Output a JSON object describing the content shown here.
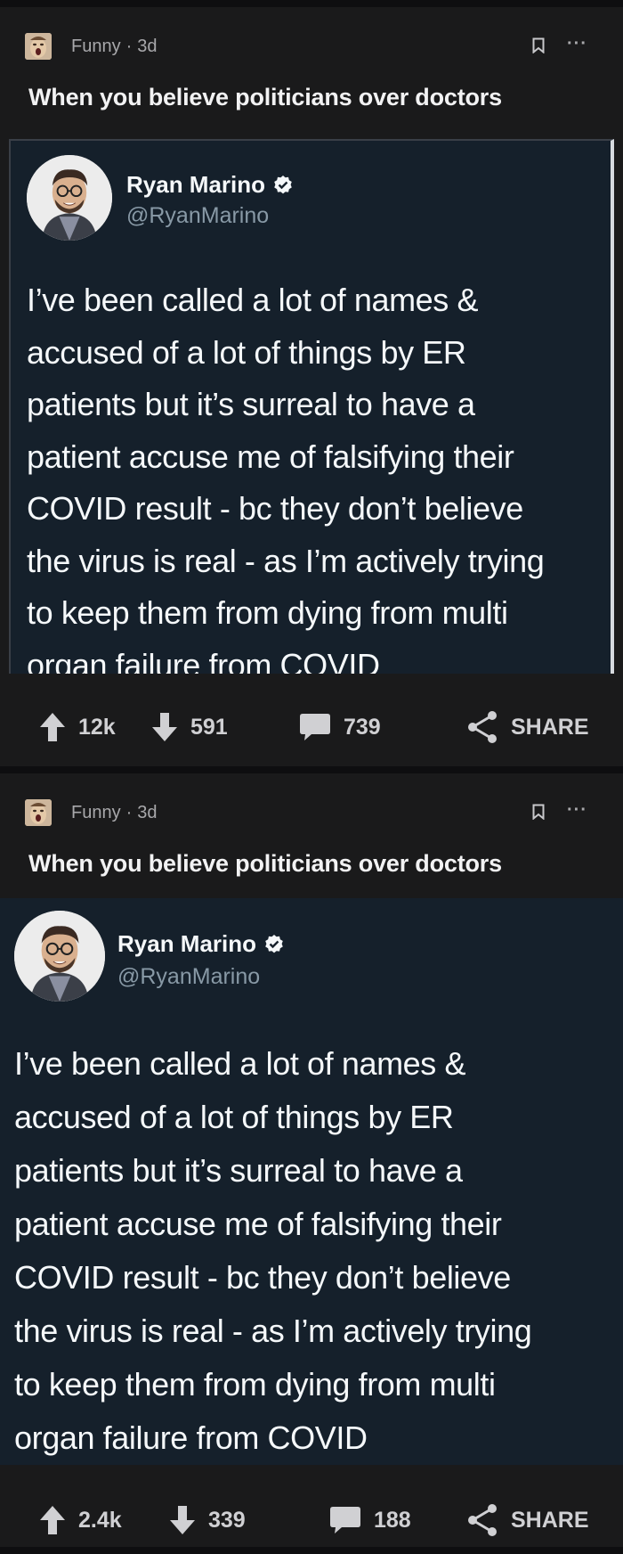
{
  "posts": [
    {
      "subreddit": "Funny",
      "age": "3d",
      "title": "When you believe politicians over doctors",
      "tweet": {
        "name": "Ryan Marino",
        "handle": "@RyanMarino",
        "text": "I’ve been called a lot of names &\naccused of a lot of things by ER\npatients but it’s surreal to have a\npatient accuse me of falsifying their\nCOVID result - bc they don’t believe\nthe virus is real - as I’m actively trying\nto keep them from dying from multi\norgan failure from COVID"
      },
      "upvotes": "12k",
      "downvotes": "591",
      "comments": "739",
      "share_label": "SHARE"
    },
    {
      "subreddit": "Funny",
      "age": "3d",
      "title": "When you believe politicians over doctors",
      "tweet": {
        "name": "Ryan Marino",
        "handle": "@RyanMarino",
        "text": "I’ve been called a lot of names &\naccused of a lot of things by ER\npatients but it’s surreal to have a\npatient accuse me of falsifying their\nCOVID result - bc they don’t believe\nthe virus is real - as I’m actively trying\nto keep them from dying from multi\norgan failure from COVID"
      },
      "upvotes": "2.4k",
      "downvotes": "339",
      "comments": "188",
      "share_label": "SHARE"
    }
  ],
  "icons": {
    "subreddit_avatar": "screaming-face-icon",
    "bookmark": "bookmark-icon",
    "more": "more-options-icon",
    "verified": "verified-badge-icon",
    "upvote": "upvote-arrow-icon",
    "downvote": "downvote-arrow-icon",
    "comment": "comment-bubble-icon",
    "share": "share-icon"
  },
  "colors": {
    "background": "#0e0e10",
    "card": "#1a1a1b",
    "tweet_bg": "#15202b",
    "verified": "#1da1f2"
  }
}
